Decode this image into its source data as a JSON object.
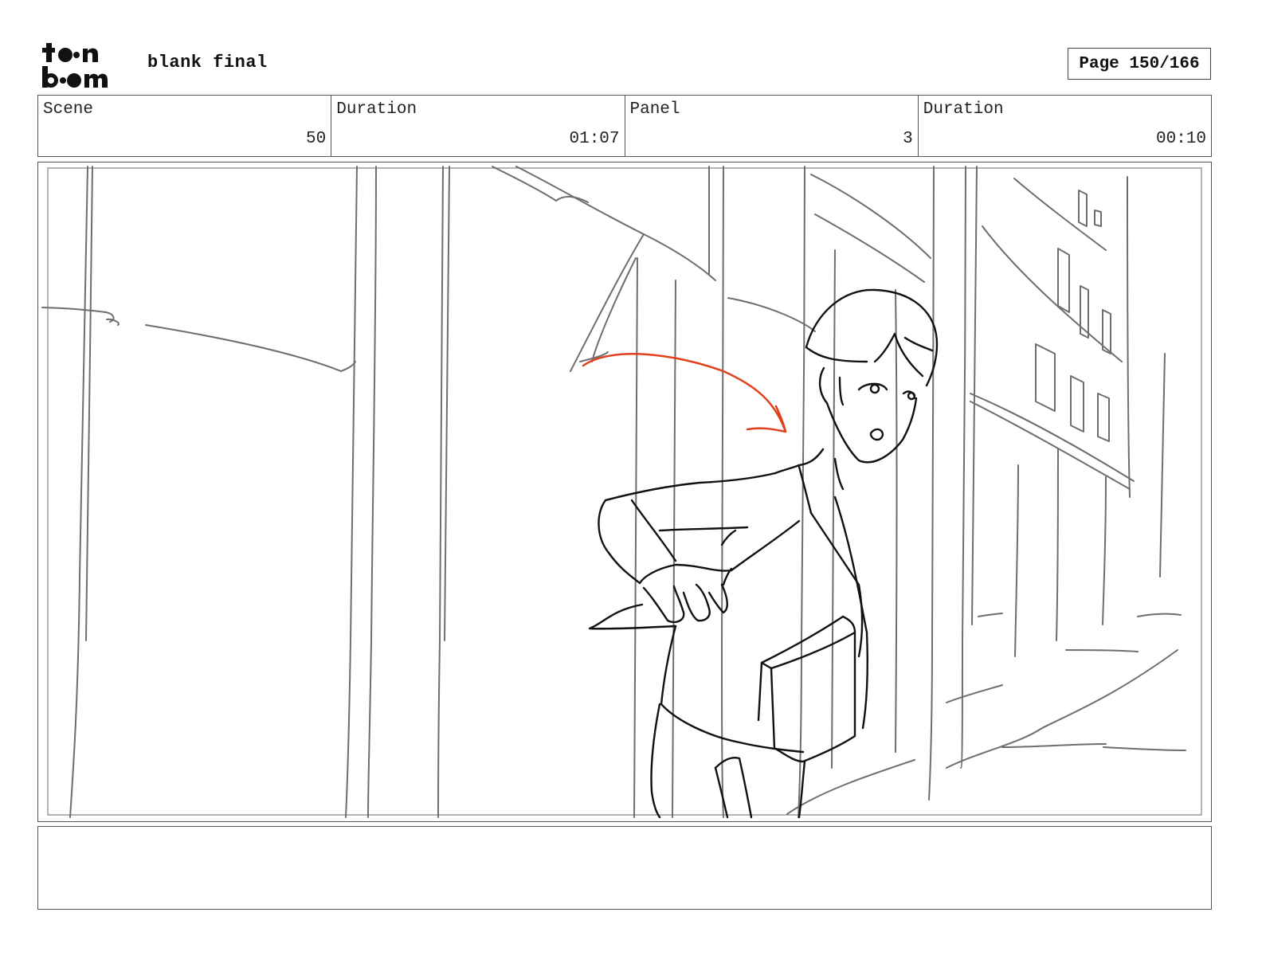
{
  "header": {
    "logo_text": "toon boom",
    "project_title": "blank final",
    "page_label": "Page 150/166"
  },
  "info": {
    "scene_label": "Scene",
    "scene_value": "50",
    "scene_duration_label": "Duration",
    "scene_duration_value": "01:07",
    "panel_label": "Panel",
    "panel_value": "3",
    "panel_duration_label": "Duration",
    "panel_duration_value": "00:10"
  },
  "notes": {
    "text": ""
  },
  "colors": {
    "sketch_gray": "#6e6e6e",
    "sketch_black": "#111111",
    "arrow_red": "#e0401c"
  }
}
